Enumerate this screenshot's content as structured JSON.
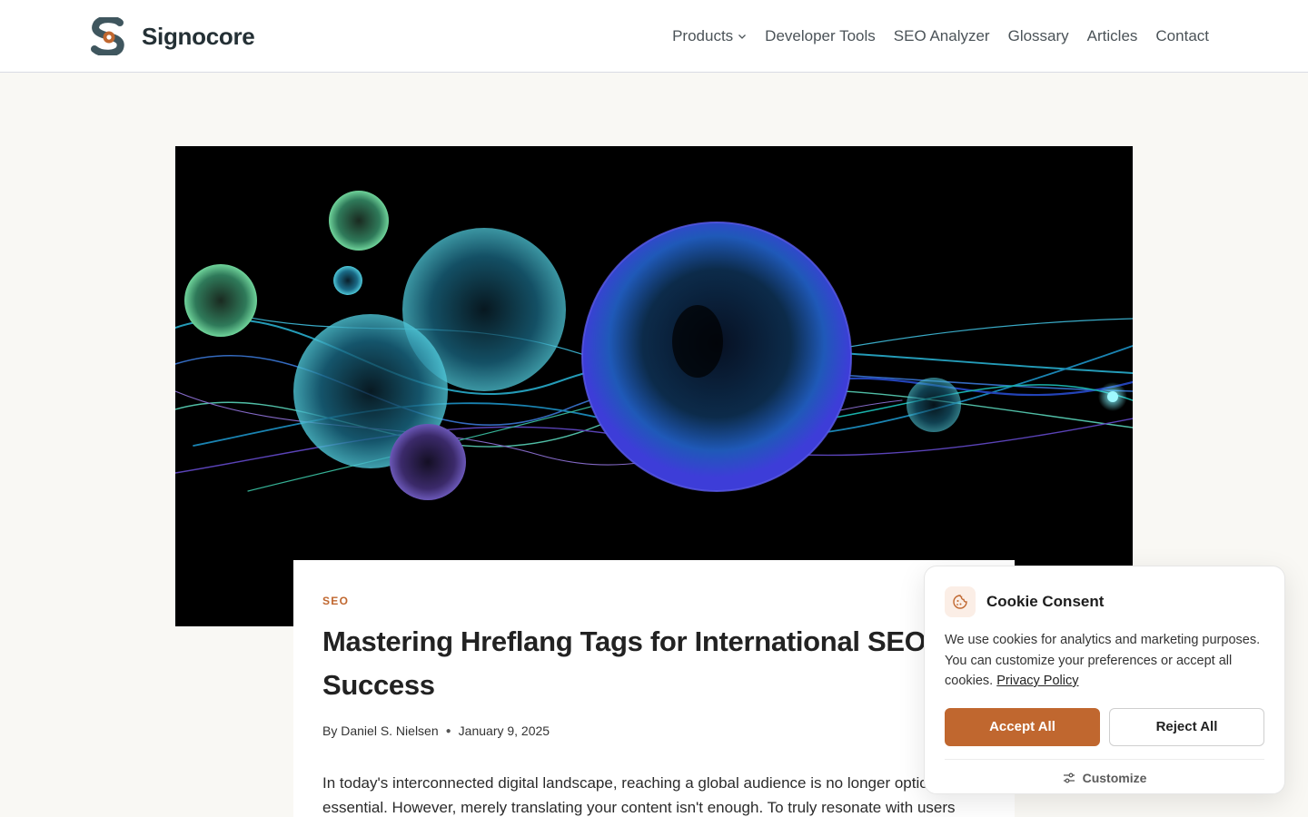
{
  "header": {
    "brand_name": "Signocore",
    "logo_icon": "signocore-s-logo-icon",
    "nav": [
      {
        "label": "Products",
        "has_dropdown": true
      },
      {
        "label": "Developer Tools"
      },
      {
        "label": "SEO Analyzer"
      },
      {
        "label": "Glossary"
      },
      {
        "label": "Articles"
      },
      {
        "label": "Contact"
      }
    ]
  },
  "hero": {
    "image": "abstract-glowing-data-spheres-image"
  },
  "article": {
    "category": "SEO",
    "title": "Mastering Hreflang Tags for International SEO Success",
    "author_prefix": "By",
    "author": "Daniel S. Nielsen",
    "date": "January 9, 2025",
    "excerpt": "In today's interconnected digital landscape, reaching a global audience is no longer optional. It is essential. However, merely translating your content isn't enough. To truly resonate with users across different regions and languages, you need to ensure search engines display the right"
  },
  "cookie_consent": {
    "icon": "cookie-icon",
    "title": "Cookie Consent",
    "text": "We use cookies for analytics and marketing purposes. You can customize your preferences or accept all cookies.",
    "privacy_link": "Privacy Policy",
    "accept_label": "Accept All",
    "reject_label": "Reject All",
    "customize_label": "Customize",
    "customize_icon": "sliders-icon"
  },
  "colors": {
    "accent": "#c0672f",
    "page_background": "#f9f8f4",
    "brand_dark": "#243035"
  }
}
